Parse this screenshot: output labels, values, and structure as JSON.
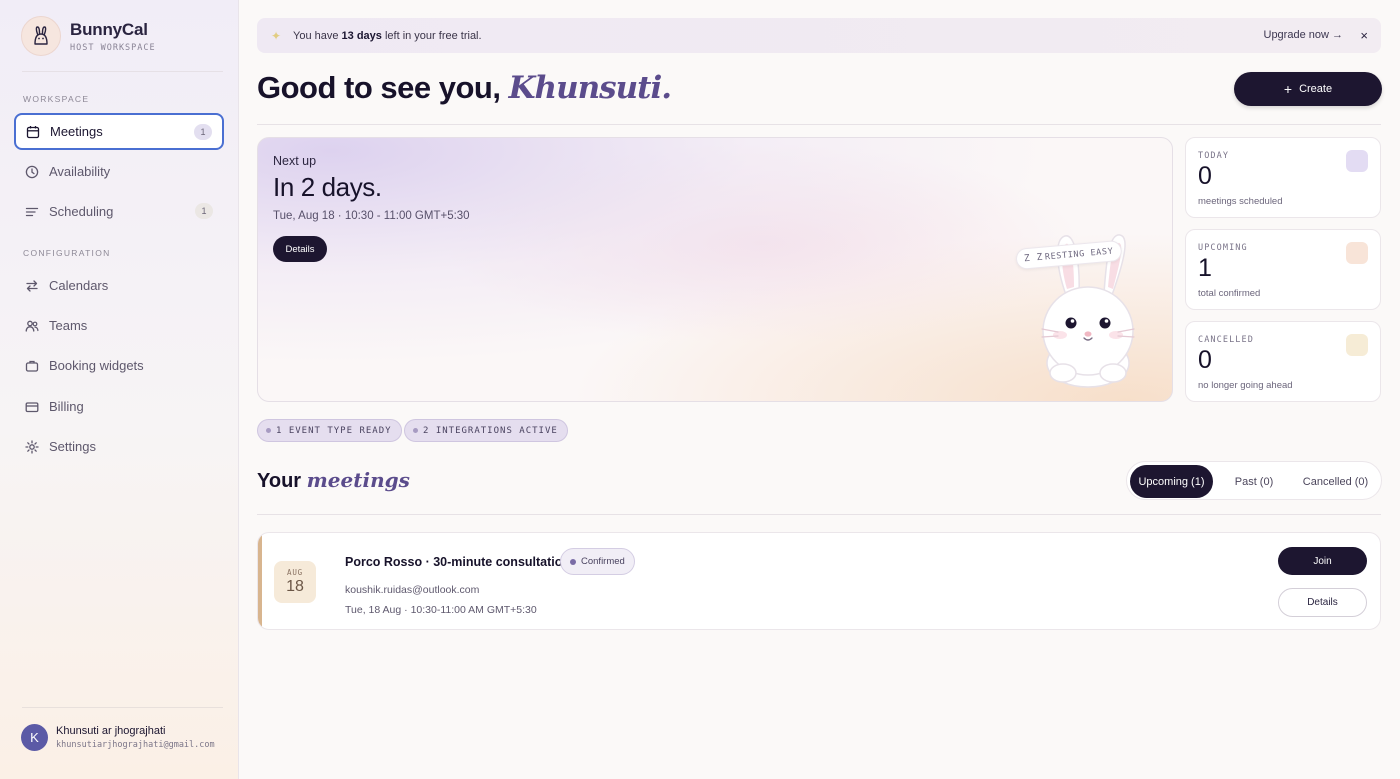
{
  "brand": {
    "name": "BunnyCal",
    "subtitle": "HOST WORKSPACE",
    "logo_icon": "bunny-logo-icon"
  },
  "sidebar": {
    "workspace_label": "WORKSPACE",
    "configuration_label": "CONFIGURATION",
    "items": [
      {
        "label": "Meetings",
        "icon": "calendar-icon",
        "count": "1",
        "active": true
      },
      {
        "label": "Availability",
        "icon": "clock-icon",
        "count": ""
      },
      {
        "label": "Scheduling",
        "icon": "list-icon",
        "count": "1"
      },
      {
        "label": "Calendars",
        "icon": "sync-icon",
        "count": ""
      },
      {
        "label": "Teams",
        "icon": "people-icon",
        "count": ""
      },
      {
        "label": "Booking widgets",
        "icon": "briefcase-icon",
        "count": ""
      },
      {
        "label": "Billing",
        "icon": "card-icon",
        "count": ""
      },
      {
        "label": "Settings",
        "icon": "gear-icon",
        "count": ""
      }
    ]
  },
  "user": {
    "initial": "K",
    "name": "Khunsuti ar jhograjhati",
    "email": "khunsutiarjhograjhati@gmail.com"
  },
  "trial": {
    "prefix": "You have ",
    "days": "13 days",
    "suffix": " left in your free trial.",
    "upgrade": "Upgrade now →",
    "close": "×"
  },
  "header": {
    "greeting": "Good to see you, ",
    "name": "Khunsuti.",
    "create": "Create"
  },
  "next_up": {
    "label": "Next up",
    "relative": "In 2 days.",
    "when": "Tue, Aug 18 · 10:30 - 11:00 GMT+5:30",
    "details": "Details",
    "zz": "Z Z",
    "status": "RESTING EASY"
  },
  "stats": [
    {
      "label": "TODAY",
      "value": "0",
      "sub": "meetings scheduled",
      "color": "#e3dcf3"
    },
    {
      "label": "UPCOMING",
      "value": "1",
      "sub": "total confirmed",
      "color": "#f8e4d8"
    },
    {
      "label": "CANCELLED",
      "value": "0",
      "sub": "no longer going ahead",
      "color": "#f6ecd6"
    }
  ],
  "chips": [
    "1 EVENT TYPE READY",
    "2 INTEGRATIONS ACTIVE"
  ],
  "meetings": {
    "title_a": "Your ",
    "title_b": "meetings",
    "tabs": [
      "Upcoming (1)",
      "Past (0)",
      "Cancelled (0)"
    ],
    "items": [
      {
        "month": "AUG",
        "day": "18",
        "title": "Porco Rosso · 30-minute consultation",
        "status": "Confirmed",
        "email": "koushik.ruidas@outlook.com",
        "time": "Tue, 18 Aug · 10:30-11:00 AM GMT+5:30",
        "join": "Join",
        "details": "Details"
      }
    ]
  },
  "colors": {
    "primary": "#1d1630",
    "accent": "#5b4c8c",
    "focus": "#4a6fd2"
  }
}
